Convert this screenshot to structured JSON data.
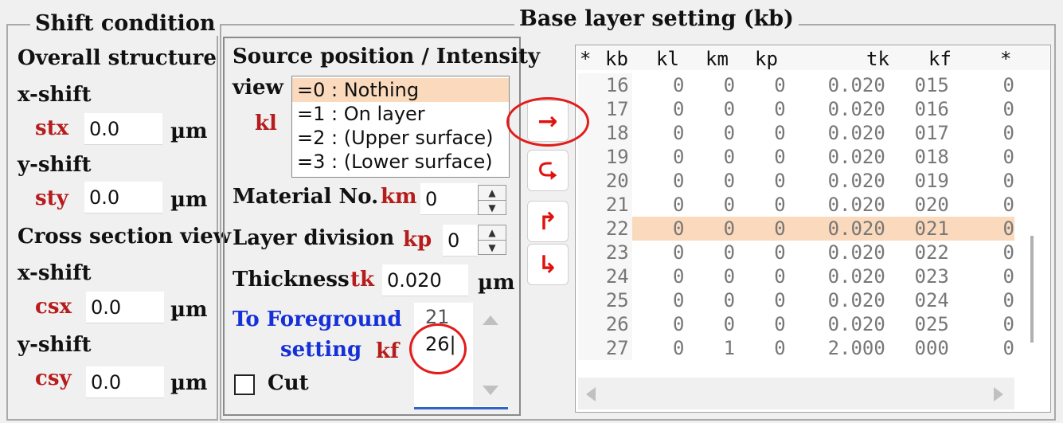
{
  "shift": {
    "title": "Shift condition",
    "overall": "Overall structure",
    "xshift1": "x-shift",
    "stx_label": "stx",
    "stx_value": "0.0",
    "unit1": "µm",
    "yshift1": "y-shift",
    "sty_label": "sty",
    "sty_value": "0.0",
    "unit2": "µm",
    "cross": "Cross section view",
    "xshift2": "x-shift",
    "csx_label": "csx",
    "csx_value": "0.0",
    "unit3": "µm",
    "yshift2": "y-shift",
    "csy_label": "csy",
    "csy_value": "0.0",
    "unit4": "µm"
  },
  "base": {
    "title": "Base layer setting (kb)",
    "source_title": "Source position / Intensity",
    "view_label": "view",
    "kl_label": "kl",
    "view_options": [
      "=0 : Nothing",
      "=1 : On layer",
      "=2 : (Upper surface)",
      "=3 : (Lower surface)"
    ],
    "material_label": "Material No.",
    "km_label": "km",
    "km_value": "0",
    "division_label": "Layer division",
    "kp_label": "kp",
    "kp_value": "0",
    "thickness_label": "Thickness",
    "tk_label": "tk",
    "tk_value": "0.020",
    "tk_unit": "µm",
    "foreground_line1": "To Foreground",
    "foreground_line2": "setting",
    "kf_label": "kf",
    "kf_values": [
      "21",
      "26|"
    ],
    "cut_label": "Cut",
    "buttons": {
      "apply": "→",
      "return": "⮎",
      "up": "↱",
      "down": "↳"
    }
  },
  "table": {
    "headers": [
      "*",
      "kb",
      "kl",
      "km",
      "kp",
      "tk",
      "kf",
      "*"
    ],
    "selected_index": 6,
    "rows": [
      [
        "16",
        "0",
        "0",
        "0",
        "0.020",
        "015",
        "0"
      ],
      [
        "17",
        "0",
        "0",
        "0",
        "0.020",
        "016",
        "0"
      ],
      [
        "18",
        "0",
        "0",
        "0",
        "0.020",
        "017",
        "0"
      ],
      [
        "19",
        "0",
        "0",
        "0",
        "0.020",
        "018",
        "0"
      ],
      [
        "20",
        "0",
        "0",
        "0",
        "0.020",
        "019",
        "0"
      ],
      [
        "21",
        "0",
        "0",
        "0",
        "0.020",
        "020",
        "0"
      ],
      [
        "22",
        "0",
        "0",
        "0",
        "0.020",
        "021",
        "0"
      ],
      [
        "23",
        "0",
        "0",
        "0",
        "0.020",
        "022",
        "0"
      ],
      [
        "24",
        "0",
        "0",
        "0",
        "0.020",
        "023",
        "0"
      ],
      [
        "25",
        "0",
        "0",
        "0",
        "0.020",
        "024",
        "0"
      ],
      [
        "26",
        "0",
        "0",
        "0",
        "0.020",
        "025",
        "0"
      ],
      [
        "27",
        "0",
        "1",
        "0",
        "2.000",
        "000",
        "0"
      ]
    ]
  },
  "colors": {
    "highlight": "#fad9bc",
    "annotation": "#e21b1b",
    "accent_red": "#b71c1c",
    "accent_blue": "#1530d8"
  }
}
